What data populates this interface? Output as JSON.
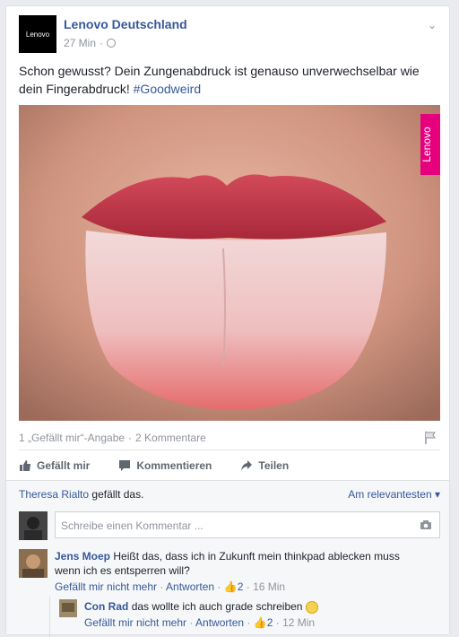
{
  "post": {
    "page_name": "Lenovo Deutschland",
    "logo_text": "Lenovo",
    "time": "27 Min",
    "text_main": "Schon gewusst? Dein Zungenabdruck ist genauso unverwechselbar wie dein Fingerabdruck!",
    "hashtag": "#Goodweird",
    "image_badge": "Lenovo",
    "likes_count": "1 „Gefällt mir“-Angabe",
    "comments_count": "2 Kommentare"
  },
  "actions": {
    "like": "Gefällt mir",
    "comment": "Kommentieren",
    "share": "Teilen"
  },
  "comments_section": {
    "liker_name": "Theresa Rialto",
    "liker_suffix": "gefällt das.",
    "sort_label": "Am relevantesten",
    "input_placeholder": "Schreibe einen Kommentar ...",
    "comments": [
      {
        "author": "Jens Moep",
        "text": "Heißt das, dass ich in Zukunft mein thinkpad ablecken muss wenn ich es entsperren will?",
        "unlike": "Gefällt mir nicht mehr",
        "reply": "Antworten",
        "likes": "2",
        "time": "16 Min"
      }
    ],
    "replies": [
      {
        "author": "Con Rad",
        "text": "das wollte ich auch grade schreiben",
        "unlike": "Gefällt mir nicht mehr",
        "reply": "Antworten",
        "likes": "2",
        "time": "12 Min"
      }
    ]
  },
  "colors": {
    "link": "#365899",
    "muted": "#90949c",
    "badge": "#e6007e"
  },
  "icons": [
    "globe-icon",
    "chevron-down-icon",
    "flag-icon",
    "like-icon",
    "comment-icon",
    "share-icon",
    "camera-icon",
    "thumb-icon",
    "smile-emoji-icon"
  ]
}
